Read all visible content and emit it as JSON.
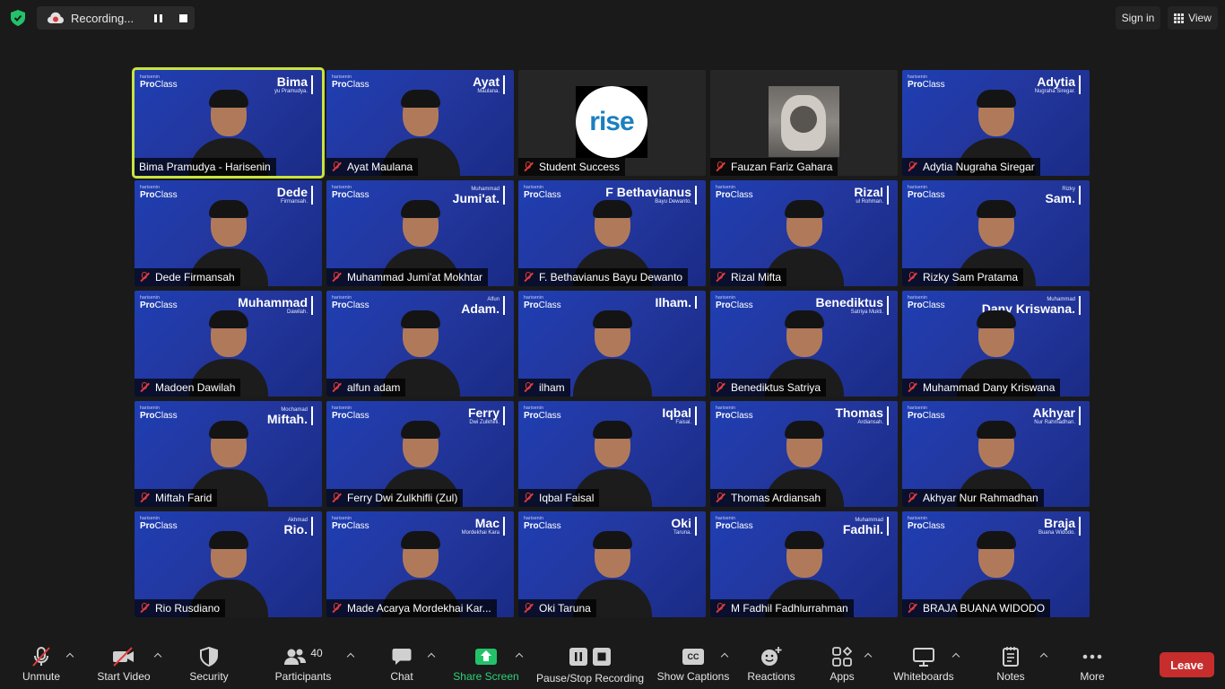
{
  "topbar": {
    "recording_label": "Recording...",
    "sign_in": "Sign in",
    "view": "View"
  },
  "tiles": [
    {
      "label": "Bima Pramudya - Harisenin",
      "first": "Bima",
      "last": "yu Pramudya.",
      "muted": false,
      "active": true
    },
    {
      "label": "Ayat Maulana",
      "first": "Ayat",
      "last": "Maulana.",
      "muted": true
    },
    {
      "label": "Student Success",
      "type": "logo",
      "logo_text": "rise",
      "muted": true
    },
    {
      "label": "Fauzan Fariz Gahara",
      "type": "photo",
      "muted": true
    },
    {
      "label": "Adytia Nugraha Siregar",
      "first": "Adytia",
      "last": "Nugraha Siregar.",
      "muted": true
    },
    {
      "label": "Dede Firmansah",
      "first": "Dede",
      "last": "Firmansah.",
      "muted": true
    },
    {
      "label": "Muhammad Jumi'at Mokhtar",
      "first": "Jumi'at.",
      "pre": "Muhammad",
      "muted": true
    },
    {
      "label": "F. Bethavianus Bayu Dewanto",
      "first": "F Bethavianus",
      "last": "Bayu Dewanto.",
      "muted": true
    },
    {
      "label": "Rizal Mifta",
      "first": "Rizal",
      "last": "ul Rohman.",
      "muted": true
    },
    {
      "label": "Rizky Sam Pratama",
      "first": "Sam.",
      "pre": "Rizky",
      "muted": true
    },
    {
      "label": "Madoen Dawilah",
      "first": "Muhammad",
      "last": "Dawilah.",
      "muted": true
    },
    {
      "label": "alfun adam",
      "first": "Adam.",
      "pre": "Alfun",
      "muted": true
    },
    {
      "label": "ilham",
      "first": "Ilham.",
      "muted": true
    },
    {
      "label": "Benediktus Satriya",
      "first": "Benediktus",
      "last": "Satriya Mukti.",
      "muted": true
    },
    {
      "label": "Muhammad Dany Kriswana",
      "first": "Dany Kriswana.",
      "pre": "Muhammad",
      "muted": true
    },
    {
      "label": "Miftah Farid",
      "first": "Miftah.",
      "pre": "Mochamad",
      "muted": true
    },
    {
      "label": "Ferry Dwi Zulkhifli (Zul)",
      "first": "Ferry",
      "last": "Dwi Zulkhifli.",
      "muted": true
    },
    {
      "label": "Iqbal Faisal",
      "first": "Iqbal",
      "last": "Faisal.",
      "muted": true
    },
    {
      "label": "Thomas Ardiansah",
      "first": "Thomas",
      "last": "Ardiansah.",
      "muted": true
    },
    {
      "label": "Akhyar Nur Rahmadhan",
      "first": "Akhyar",
      "last": "Nur Rahmadhan.",
      "muted": true
    },
    {
      "label": "Rio Rusdiano",
      "first": "Rio.",
      "pre": "Akhmad",
      "muted": true
    },
    {
      "label": "Made Acarya Mordekhai Kar...",
      "first": "Mac",
      "last": "Mordekhai Kara",
      "muted": true
    },
    {
      "label": "Oki Taruna",
      "first": "Oki",
      "last": "Taruna.",
      "muted": true
    },
    {
      "label": "M Fadhil Fadhlurrahman",
      "first": "Fadhil.",
      "pre": "Muhammad",
      "muted": true
    },
    {
      "label": "BRAJA BUANA WIDODO",
      "first": "Braja",
      "last": "Buana Widodo.",
      "muted": true
    }
  ],
  "brand": {
    "small": "harisenin",
    "pro": "Pro",
    "class": "Class"
  },
  "toolbar": {
    "unmute": "Unmute",
    "start_video": "Start Video",
    "security": "Security",
    "participants": "Participants",
    "participants_count": "40",
    "chat": "Chat",
    "share_screen": "Share Screen",
    "pause_stop": "Pause/Stop Recording",
    "show_captions": "Show Captions",
    "captions_icon_text": "CC",
    "reactions": "Reactions",
    "apps": "Apps",
    "whiteboards": "Whiteboards",
    "notes": "Notes",
    "more": "More",
    "leave": "Leave"
  },
  "colors": {
    "active_speaker": "#c9e33f",
    "share_green": "#23c26a",
    "leave_red": "#c72d2d",
    "tile_blue": "#1f3fb3"
  }
}
